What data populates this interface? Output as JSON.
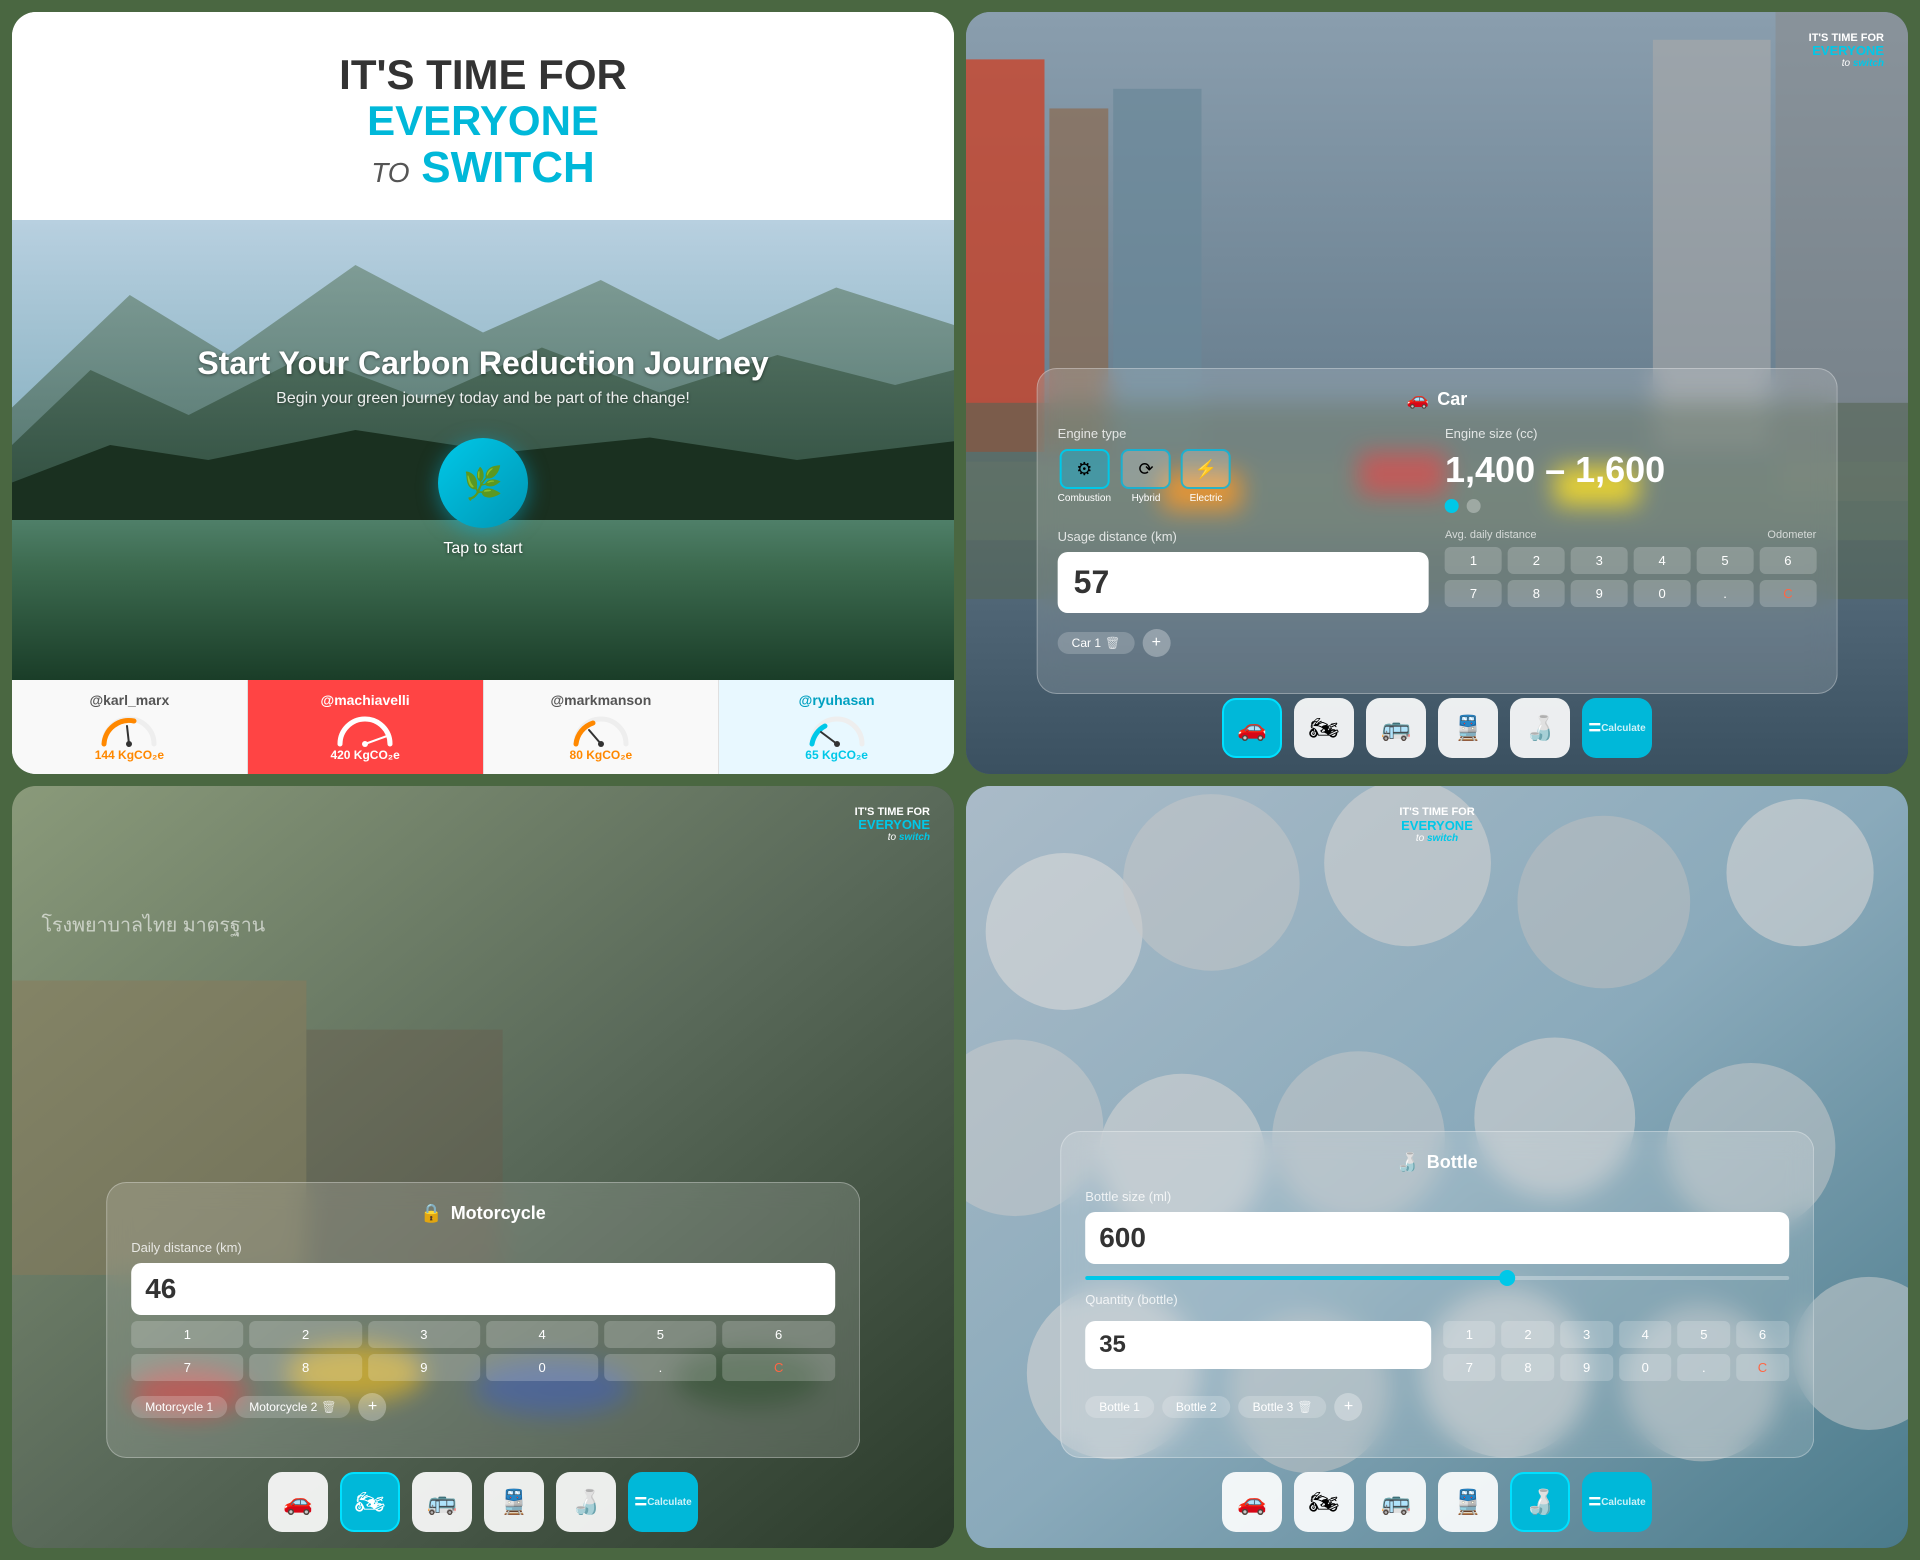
{
  "app": {
    "brand": {
      "line1": "IT'S TIME FOR",
      "line2": "EVERYONE",
      "line3": "to",
      "line4": "switch"
    }
  },
  "panel1": {
    "title": "Start Your Carbon Reduction Journey",
    "subtitle": "Begin your green journey today and be part of the change!",
    "tap_label": "Tap to start",
    "users": [
      {
        "username": "@karl_marx",
        "co2": "144 KgCO₂e",
        "color": "#ff8800"
      },
      {
        "username": "@machiavelli",
        "co2": "420 KgCO₂e",
        "color": "#ffffff",
        "highlight": true
      },
      {
        "username": "@markmanson",
        "co2": "80 KgCO₂e",
        "color": "#ff8800"
      },
      {
        "username": "@ryuhasan",
        "co2": "65 KgCO₂e",
        "color": "#00c8e8"
      }
    ]
  },
  "panel2": {
    "vehicle_type": "Car",
    "engine_type_label": "Engine type",
    "engine_size_label": "Engine size (cc)",
    "engine_size_value": "1,400 – 1,600",
    "engine_options": [
      "Combustion",
      "Hybrid",
      "Electric"
    ],
    "usage_distance_label": "Usage distance (km)",
    "usage_distance_value": "57",
    "avg_daily_label": "Avg. daily distance",
    "odometer_label": "Odometer",
    "numpad": [
      "1",
      "2",
      "3",
      "4",
      "5",
      "6",
      "7",
      "8",
      "9",
      "0",
      ".",
      "C"
    ],
    "tabs": [
      "Car 1"
    ],
    "add_label": "+",
    "calculate_label": "=",
    "nav_icons": [
      "car",
      "motorcycle",
      "bus",
      "train",
      "bottle"
    ]
  },
  "panel3": {
    "vehicle_type": "Motorcycle",
    "daily_distance_label": "Daily distance (km)",
    "daily_distance_value": "46",
    "numpad": [
      "1",
      "2",
      "3",
      "4",
      "5",
      "6",
      "7",
      "8",
      "9",
      "0",
      ".",
      "C"
    ],
    "tabs": [
      "Motorcycle 1",
      "Motorcycle 2"
    ],
    "add_label": "+",
    "calculate_label": "=",
    "nav_icons": [
      "car",
      "motorcycle",
      "bus",
      "train",
      "bottle"
    ],
    "logo": {
      "line1": "IT'S TIME FOR",
      "line2": "EVERYONE",
      "line3": "to switch"
    }
  },
  "panel4": {
    "item_type": "Bottle",
    "bottle_size_label": "Bottle size (ml)",
    "bottle_size_value": "600",
    "quantity_label": "Quantity (bottle)",
    "quantity_value": "35",
    "slider_percent": 60,
    "numpad": [
      "1",
      "2",
      "3",
      "4",
      "5",
      "6",
      "7",
      "8",
      "9",
      "0",
      ".",
      "C"
    ],
    "tabs": [
      "Bottle 1",
      "Bottle 2",
      "Bottle 3"
    ],
    "add_label": "+",
    "calculate_label": "=",
    "nav_icons": [
      "car",
      "motorcycle",
      "bus",
      "train",
      "bottle"
    ],
    "logo": {
      "line1": "IT'S TIME FOR",
      "line2": "EVERYONE",
      "line3": "to switch"
    }
  },
  "icons": {
    "leaf": "🌿",
    "car": "🚗",
    "motorcycle": "🏍",
    "bus": "🚌",
    "train": "🚆",
    "bottle": "🍶",
    "lock": "🔒",
    "equals": "=",
    "combustion": "⚙️",
    "hybrid": "🔄",
    "electric": "⚡"
  }
}
